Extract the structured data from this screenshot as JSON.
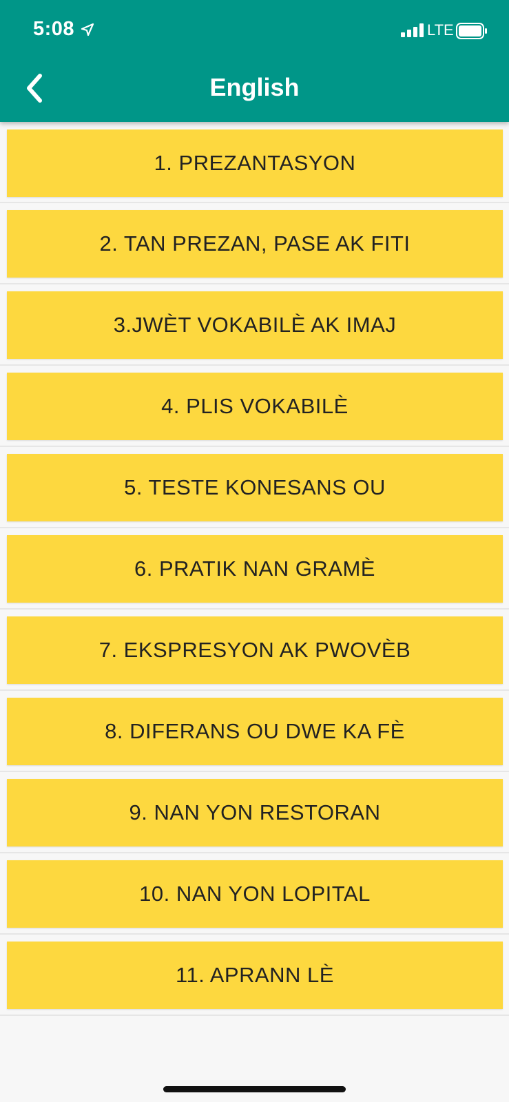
{
  "status_bar": {
    "time": "5:08",
    "network": "LTE",
    "icons": [
      "location-arrow-icon",
      "signal-icon",
      "battery-icon"
    ]
  },
  "header": {
    "title": "English",
    "back_icon": "chevron-left-icon",
    "background_color": "#009688"
  },
  "list": {
    "item_color": "#fdd83f",
    "items": [
      {
        "label": "1. PREZANTASYON"
      },
      {
        "label": "2. TAN PREZAN, PASE AK FITI"
      },
      {
        "label": "3.JWÈT VOKABILÈ AK IMAJ"
      },
      {
        "label": "4. PLIS VOKABILÈ"
      },
      {
        "label": "5. TESTE KONESANS OU"
      },
      {
        "label": "6. PRATIK NAN GRAMÈ"
      },
      {
        "label": "7. EKSPRESYON AK PWOVÈB"
      },
      {
        "label": "8. DIFERANS OU DWE KA FÈ"
      },
      {
        "label": "9. NAN YON RESTORAN"
      },
      {
        "label": "10. NAN YON LOPITAL"
      },
      {
        "label": "11. APRANN LÈ"
      }
    ]
  }
}
